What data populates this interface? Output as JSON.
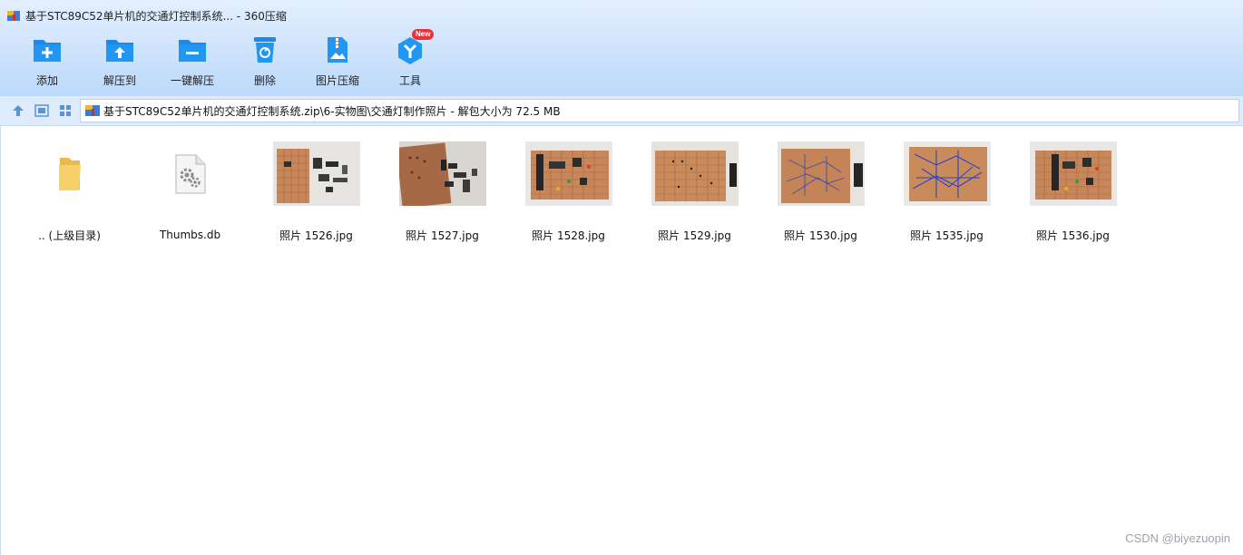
{
  "window": {
    "title": "基于STC89C52单片机的交通灯控制系统... - 360压缩"
  },
  "toolbar": {
    "items": [
      {
        "label": "添加",
        "icon": "add-archive-icon"
      },
      {
        "label": "解压到",
        "icon": "extract-to-icon"
      },
      {
        "label": "一键解压",
        "icon": "one-click-extract-icon"
      },
      {
        "label": "删除",
        "icon": "delete-icon"
      },
      {
        "label": "图片压缩",
        "icon": "image-compress-icon"
      },
      {
        "label": "工具",
        "icon": "tools-icon",
        "badge": "New"
      }
    ]
  },
  "navbar": {
    "path": "基于STC89C52单片机的交通灯控制系统.zip\\6-实物图\\交通灯制作照片 - 解包大小为 72.5 MB"
  },
  "files": [
    {
      "name": ".. (上级目录)",
      "kind": "parent-folder",
      "icon": "folder-icon"
    },
    {
      "name": "Thumbs.db",
      "kind": "system-file",
      "icon": "settings-file-icon"
    },
    {
      "name": "照片 1526.jpg",
      "kind": "image",
      "icon": "photo-thumbnail"
    },
    {
      "name": "照片 1527.jpg",
      "kind": "image",
      "icon": "photo-thumbnail"
    },
    {
      "name": "照片 1528.jpg",
      "kind": "image",
      "icon": "photo-thumbnail"
    },
    {
      "name": "照片 1529.jpg",
      "kind": "image",
      "icon": "photo-thumbnail"
    },
    {
      "name": "照片 1530.jpg",
      "kind": "image",
      "icon": "photo-thumbnail"
    },
    {
      "name": "照片 1535.jpg",
      "kind": "image",
      "icon": "photo-thumbnail"
    },
    {
      "name": "照片 1536.jpg",
      "kind": "image",
      "icon": "photo-thumbnail"
    }
  ],
  "watermark": "CSDN @biyezuopin",
  "colors": {
    "accent": "#1e88e5",
    "toolbar_bg": "#cfe3fc",
    "pcb": "#c8875a",
    "badge": "#e8323c"
  }
}
